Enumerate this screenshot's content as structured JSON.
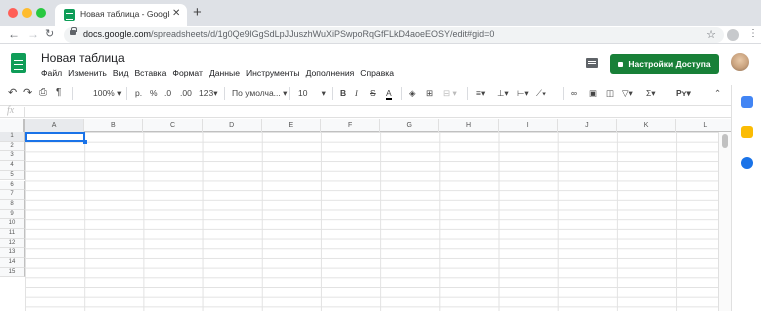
{
  "browser": {
    "tab_title": "Новая таблица - Google Табл...",
    "new_tab_label": "+",
    "url_host": "docs.google.com",
    "url_rest": "/spreadsheets/d/1g0Qe9lGgSdLpJJuszhWuXiPSwpoRqGfFLkD4aoeEOSY/edit#gid=0"
  },
  "sheets": {
    "doc_title": "Новая таблица",
    "menu": [
      "Файл",
      "Изменить",
      "Вид",
      "Вставка",
      "Формат",
      "Данные",
      "Инструменты",
      "Дополнения",
      "Справка"
    ],
    "share_label": "Настройки Доступа"
  },
  "toolbar": {
    "zoom": "100%",
    "currency": "р.",
    "percent": "%",
    "dec_less": ".0",
    "dec_more": ".00",
    "number_format": "123",
    "font": "По умолча...",
    "font_size": "10",
    "bold": "B",
    "italic": "I",
    "strike": "S",
    "text_color": "A"
  },
  "fx_label": "fx",
  "grid": {
    "columns": [
      "A",
      "B",
      "C",
      "D",
      "E",
      "F",
      "G",
      "H",
      "I",
      "J",
      "K",
      "L"
    ],
    "rows": [
      "1",
      "2",
      "3",
      "4",
      "5",
      "6",
      "7",
      "8",
      "9",
      "10",
      "11",
      "12",
      "13",
      "14",
      "15"
    ],
    "selected_cell": "A1"
  }
}
